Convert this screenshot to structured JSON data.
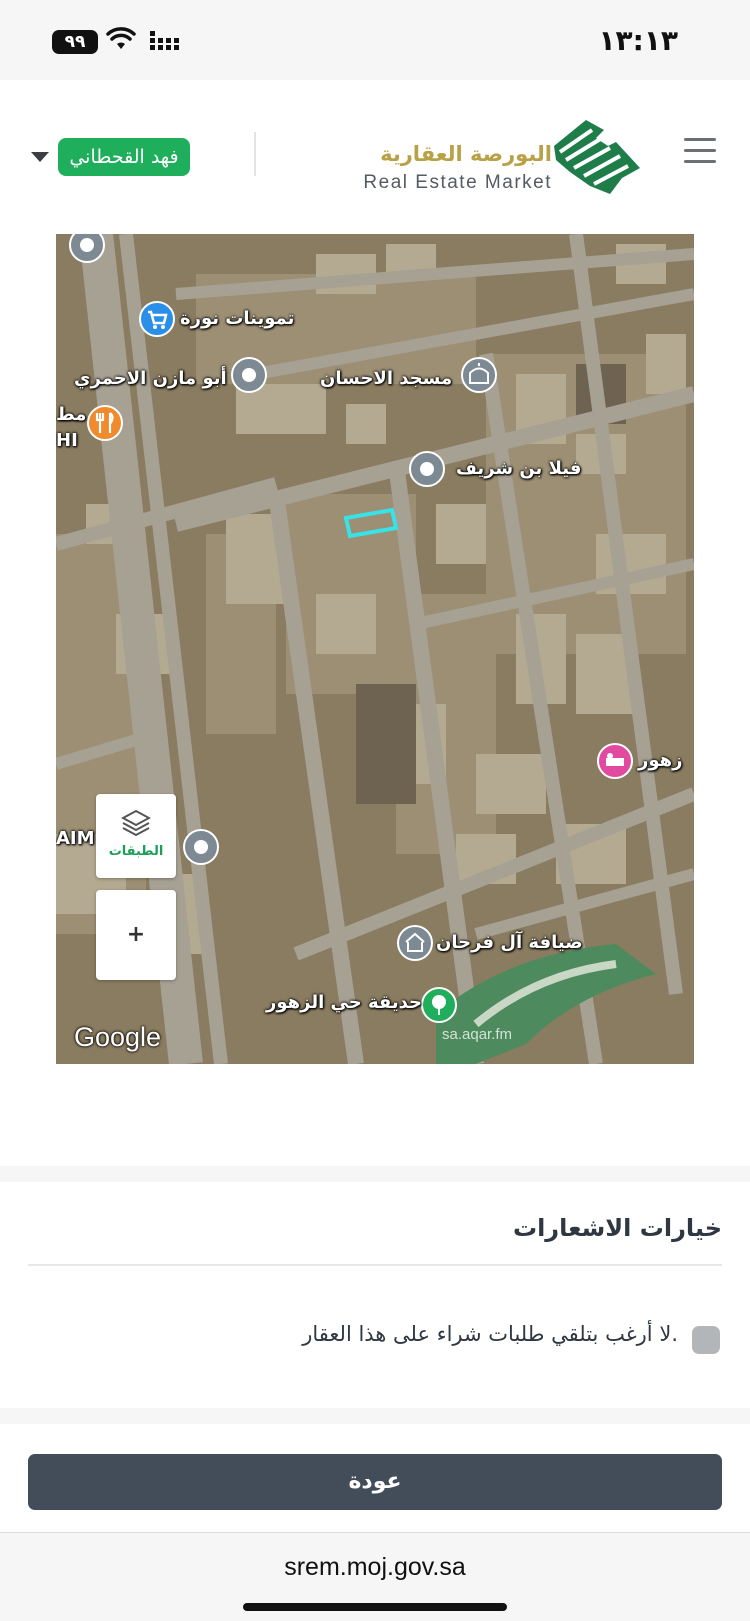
{
  "status_bar": {
    "time": "١٣:١٣",
    "battery": "٩٩"
  },
  "header": {
    "logo_ar": "البورصة العقارية",
    "logo_en": "Real Estate Market",
    "user_name": "فهد القحطاني"
  },
  "map": {
    "labels": {
      "tamweenat": "تموينات نورة",
      "abu_mazen": "أبو مازن الاحمري",
      "mosque": "مسجد الاحسان",
      "villa": "فيلا بن شريف",
      "diyafa": "ضيافة آل فرحان",
      "garden": "حديقة حي الزهور",
      "zuhur": "زهور",
      "aim": "AIM",
      "hi": "HI",
      "mat": "مط"
    },
    "layers_label": "الطبقات",
    "zoom_in": "+",
    "google": "Google",
    "watermark": "sa.aqar.fm"
  },
  "notifications": {
    "title": "خيارات الاشعارات",
    "option": "لا أرغب بتلقي طلبات شراء على هذا العقار."
  },
  "footer": {
    "back": "عودة"
  },
  "browser": {
    "url": "srem.moj.gov.sa"
  },
  "colors": {
    "brand_green": "#1fae5b",
    "brand_gold": "#b8a146",
    "button_dark": "#434c59",
    "parcel": "#37e3e6"
  }
}
